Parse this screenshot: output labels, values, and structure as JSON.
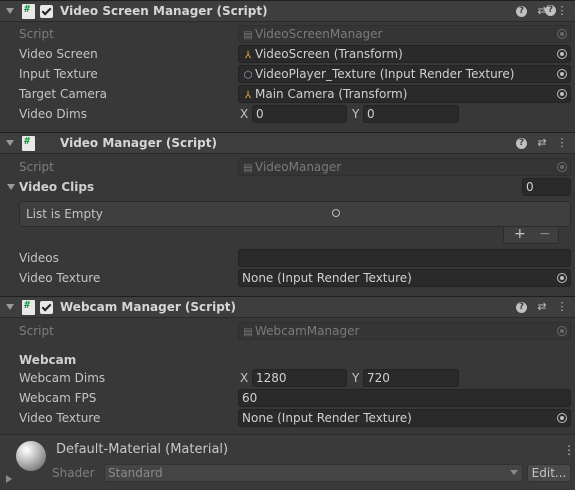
{
  "video_screen_manager": {
    "title": "Video Screen Manager (Script)",
    "script_label": "Script",
    "script_value": "VideoScreenManager",
    "video_screen_label": "Video Screen",
    "video_screen_value": "VideoScreen (Transform)",
    "input_texture_label": "Input Texture",
    "input_texture_value": "VideoPlayer_Texture (Input Render Texture)",
    "target_camera_label": "Target Camera",
    "target_camera_value": "Main Camera (Transform)",
    "video_dims_label": "Video Dims",
    "x_label": "X",
    "x_value": "0",
    "y_label": "Y",
    "y_value": "0"
  },
  "video_manager": {
    "title": "Video Manager (Script)",
    "script_label": "Script",
    "script_value": "VideoManager",
    "video_clips_label": "Video Clips",
    "video_clips_count": "0",
    "list_empty_text": "List is Empty",
    "add_label": "+",
    "remove_label": "−",
    "videos_label": "Videos",
    "videos_value": "",
    "video_texture_label": "Video Texture",
    "video_texture_value": "None (Input Render Texture)"
  },
  "webcam_manager": {
    "title": "Webcam Manager (Script)",
    "script_label": "Script",
    "script_value": "WebcamManager",
    "section_header": "Webcam",
    "webcam_dims_label": "Webcam Dims",
    "x_label": "X",
    "x_value": "1280",
    "y_label": "Y",
    "y_value": "720",
    "webcam_fps_label": "Webcam FPS",
    "webcam_fps_value": "60",
    "video_texture_label": "Video Texture",
    "video_texture_value": "None (Input Render Texture)"
  },
  "material": {
    "title": "Default-Material (Material)",
    "shader_label": "Shader",
    "shader_value": "Standard",
    "edit_label": "Edit..."
  },
  "colors": {
    "panel_bg": "#383838",
    "header_bg": "#3e3e3e",
    "field_bg": "#2a2a2a",
    "script_icon_green": "#1a9a3a"
  }
}
